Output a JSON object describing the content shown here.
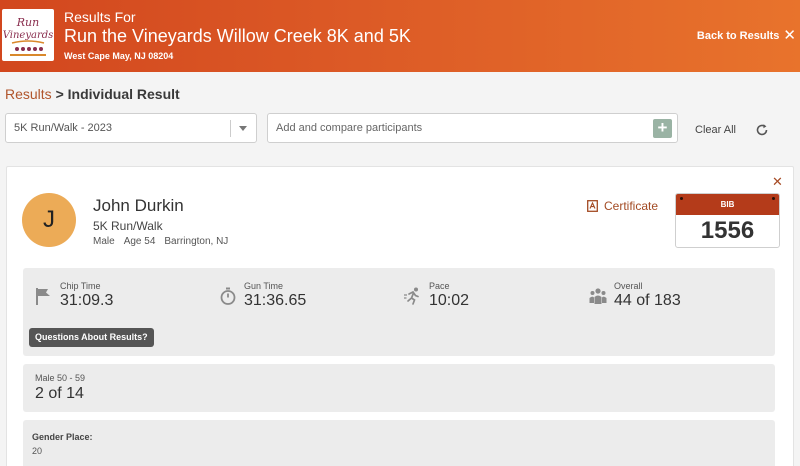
{
  "header": {
    "subtitle": "Results For",
    "title": "Run the Vineyards Willow Creek 8K and 5K",
    "location": "West Cape May, NJ 08204",
    "back_label": "Back to Results",
    "logo_text": "Run the Vineyards",
    "logo_sub": "WILLOW CREEK 8K/5K"
  },
  "breadcrumb": {
    "parent": "Results",
    "separator": " > ",
    "current": "Individual Result"
  },
  "controls": {
    "race_select_value": "5K Run/Walk - 2023",
    "compare_placeholder": "Add and compare participants",
    "clear_all": "Clear All"
  },
  "participant": {
    "initial": "J",
    "name": "John Durkin",
    "race": "5K Run/Walk",
    "gender": "Male",
    "age": "Age 54",
    "city": "Barrington, NJ",
    "certificate_label": "Certificate",
    "bib_label": "BIB",
    "bib_number": "1556"
  },
  "stats": [
    {
      "label": "Chip Time",
      "value": "31:09.3",
      "icon": "flag-icon"
    },
    {
      "label": "Gun Time",
      "value": "31:36.65",
      "icon": "stopwatch-icon"
    },
    {
      "label": "Pace",
      "value": "10:02",
      "icon": "runner-icon"
    },
    {
      "label": "Overall",
      "value": "44 of 183",
      "icon": "group-icon"
    }
  ],
  "questions_label": "Questions About Results?",
  "division": {
    "label": "Male 50 - 59",
    "value": "2 of 14"
  },
  "gender_place": {
    "label": "Gender Place:",
    "value": "20"
  },
  "colors": {
    "header_start": "#d2471e",
    "header_end": "#e8732c",
    "accent": "#a34b24",
    "avatar": "#ecab57",
    "bib": "#b43b1a"
  }
}
